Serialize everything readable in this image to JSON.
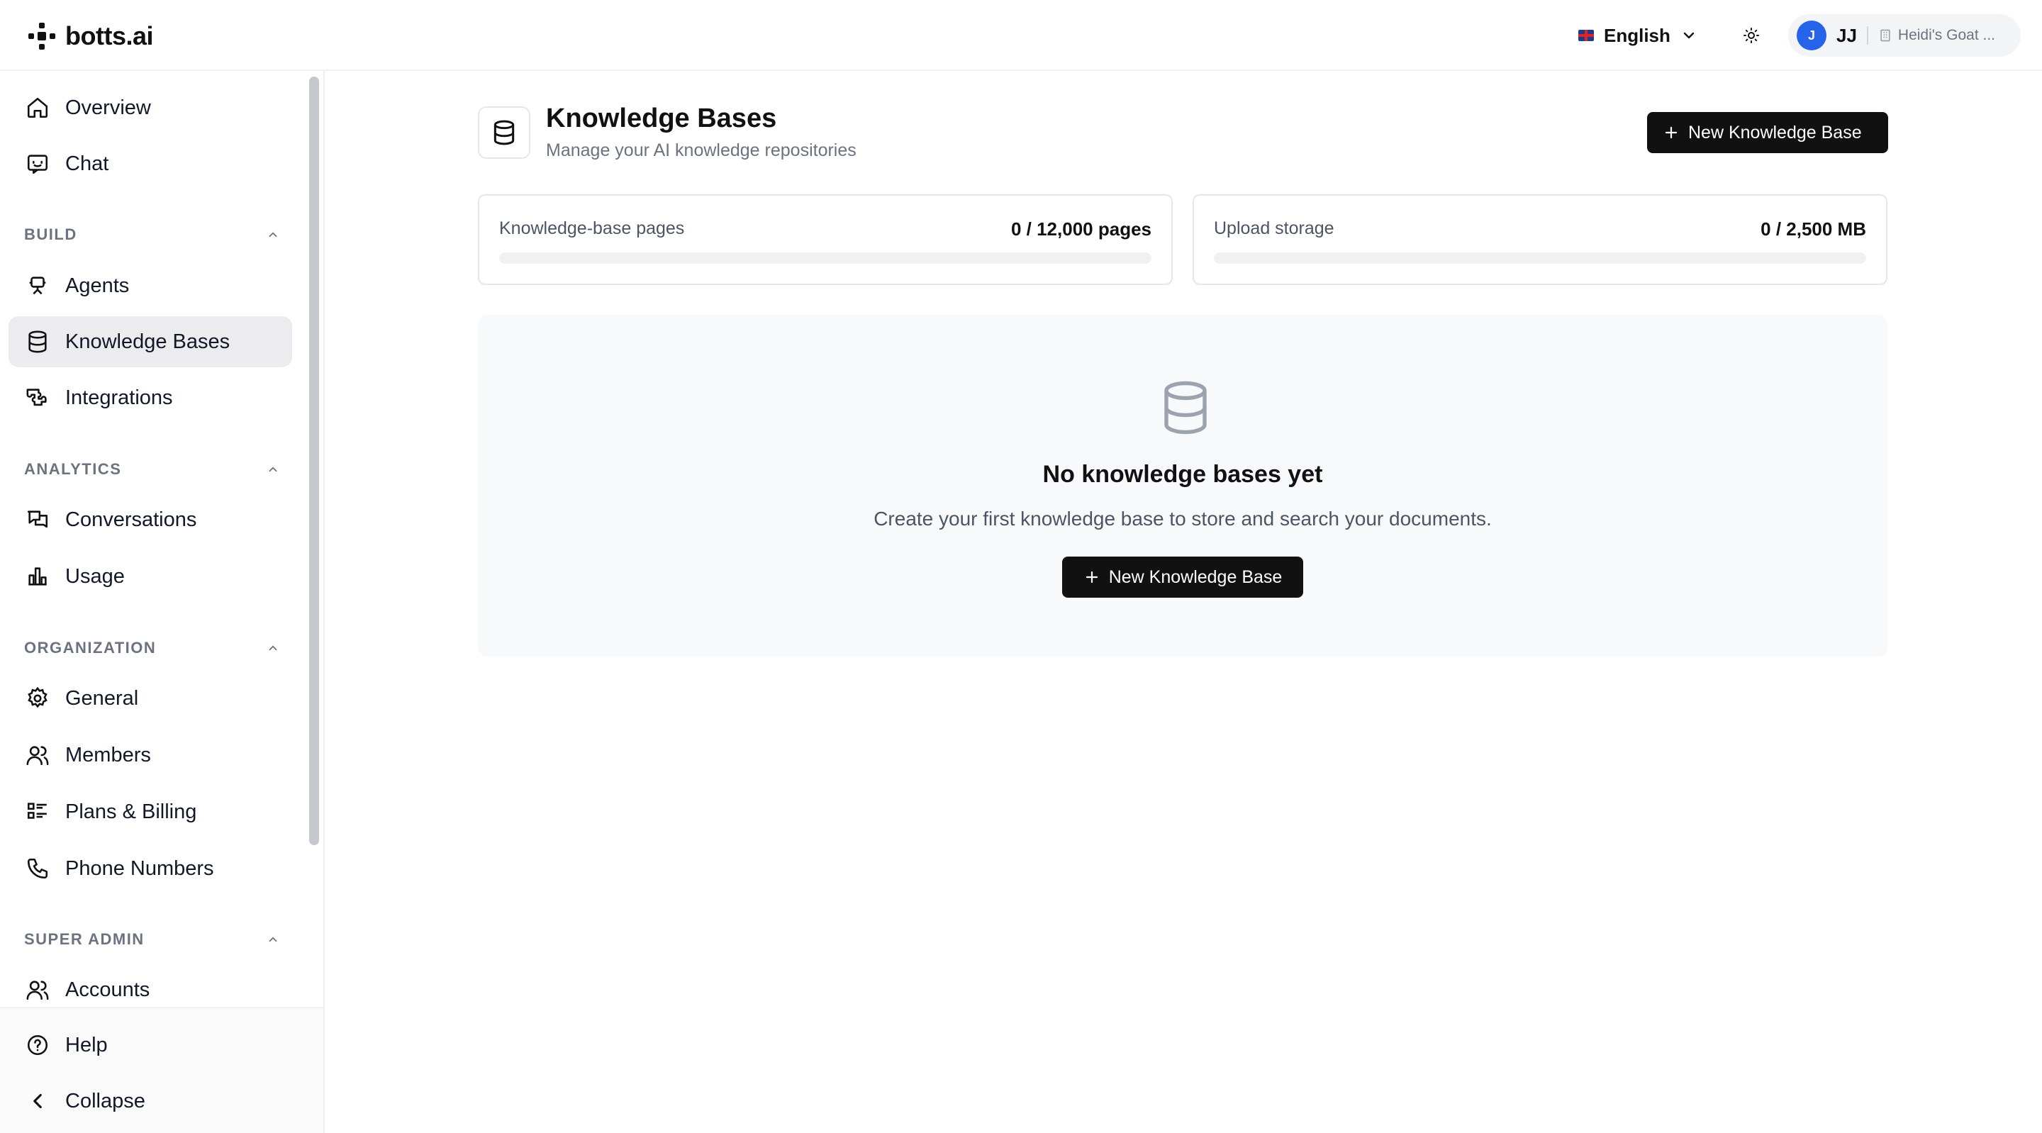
{
  "app": {
    "brand": "botts.ai"
  },
  "header": {
    "language": "English",
    "account": {
      "avatar_letter": "J",
      "initials": "JJ",
      "organization": "Heidi's Goat ..."
    }
  },
  "sidebar": {
    "top_items": [
      {
        "label": "Overview",
        "icon": "home-icon"
      },
      {
        "label": "Chat",
        "icon": "chat-icon"
      }
    ],
    "sections": {
      "build": {
        "title": "BUILD",
        "items": [
          "Agents",
          "Knowledge Bases",
          "Integrations"
        ]
      },
      "analytics": {
        "title": "ANALYTICS",
        "items": [
          "Conversations",
          "Usage"
        ]
      },
      "organization": {
        "title": "ORGANIZATION",
        "items": [
          "General",
          "Members",
          "Plans & Billing",
          "Phone Numbers"
        ]
      },
      "super_admin": {
        "title": "SUPER ADMIN",
        "items": [
          "Accounts"
        ]
      }
    },
    "active_item": "Knowledge Bases",
    "bottom": {
      "help": "Help",
      "collapse": "Collapse"
    }
  },
  "page": {
    "title": "Knowledge Bases",
    "subtitle": "Manage your AI knowledge repositories",
    "new_button": "New Knowledge Base"
  },
  "stats": {
    "pages": {
      "label": "Knowledge-base pages",
      "value": "0 / 12,000 pages",
      "used_fraction": 0
    },
    "storage": {
      "label": "Upload storage",
      "value": "0 / 2,500 MB",
      "used_fraction": 0
    }
  },
  "empty_state": {
    "title": "No knowledge bases yet",
    "text": "Create your first knowledge base to store and search your documents.",
    "button": "New Knowledge Base"
  }
}
